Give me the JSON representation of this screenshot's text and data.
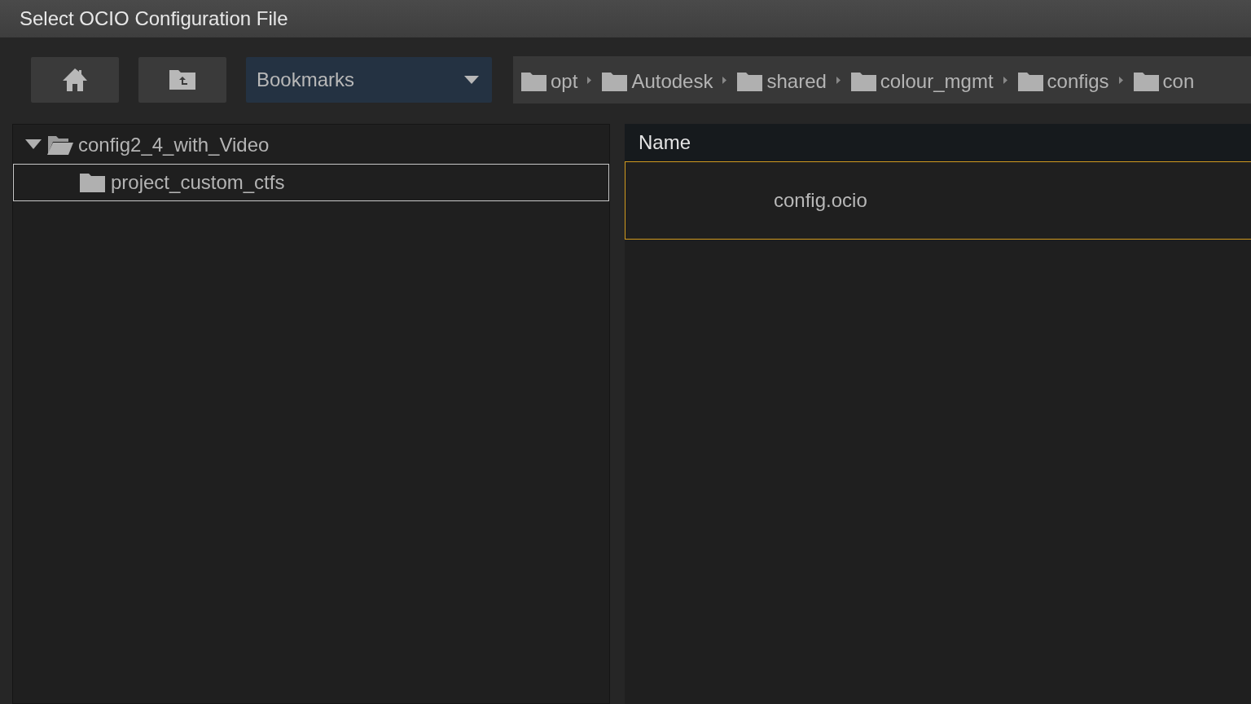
{
  "window": {
    "title": "Select OCIO Configuration File"
  },
  "toolbar": {
    "bookmarks": {
      "value": "Bookmarks"
    }
  },
  "breadcrumb": [
    {
      "label": "opt"
    },
    {
      "label": "Autodesk"
    },
    {
      "label": "shared"
    },
    {
      "label": "colour_mgmt"
    },
    {
      "label": "configs"
    },
    {
      "label": "con"
    }
  ],
  "tree": [
    {
      "label": "config2_4_with_Video",
      "expanded": true,
      "selected": false,
      "children": [
        {
          "label": "project_custom_ctfs",
          "selected": true
        }
      ]
    }
  ],
  "file_list": {
    "columns": [
      "Name"
    ],
    "rows": [
      {
        "name": "config.ocio",
        "selected": true
      }
    ]
  }
}
